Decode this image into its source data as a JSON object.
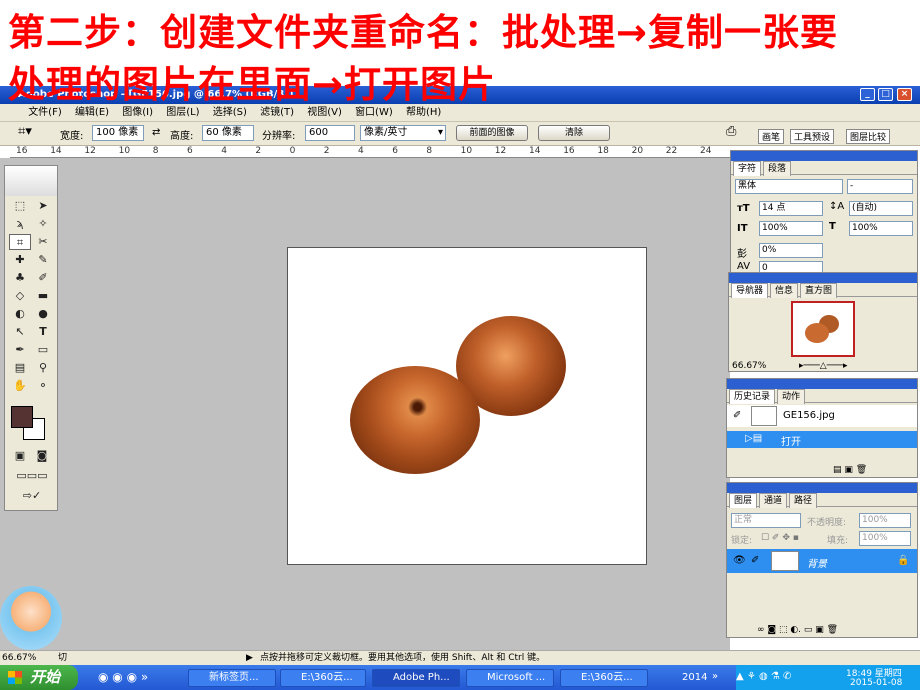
{
  "slide": {
    "heading_line1": "第二步：创建文件夹重命名：批处理→复制一张要",
    "heading_line2": "处理的图片在里面→打开图片"
  },
  "window": {
    "title": "Adobe Photoshop - [GE156.jpg @ 66.7% (RGB/8)]",
    "buttons": [
      "_",
      "□",
      "×"
    ]
  },
  "menu": [
    "文件(F)",
    "编辑(E)",
    "图像(I)",
    "图层(L)",
    "选择(S)",
    "滤镜(T)",
    "视图(V)",
    "窗口(W)",
    "帮助(H)"
  ],
  "options": {
    "width_label": "宽度:",
    "width_value": "100 像素",
    "height_label": "高度:",
    "height_value": "60 像素",
    "resolution_label": "分辨率:",
    "resolution_value": "600",
    "unit_value": "像素/英寸",
    "front_image_button": "前面的图像",
    "clear_button": "清除",
    "palette_tabs": [
      "画笔",
      "工具预设",
      "图层比较"
    ]
  },
  "ruler_labels": [
    "16",
    "14",
    "12",
    "10",
    "8",
    "6",
    "4",
    "2",
    "0",
    "2",
    "4",
    "6",
    "8",
    "10",
    "12",
    "14",
    "16",
    "18",
    "20",
    "22",
    "24"
  ],
  "character_panel": {
    "tabs": [
      "字符",
      "段落"
    ],
    "font": "黑体",
    "style": "-",
    "size": "14 点",
    "leading": "(自动)",
    "vscale": "100%",
    "hscale": "100%",
    "baseline": "0%",
    "tracking": "0"
  },
  "navigator_panel": {
    "tabs": [
      "导航器",
      "信息",
      "直方图"
    ],
    "zoom": "66.67%"
  },
  "history_panel": {
    "tabs": [
      "历史记录",
      "动作"
    ],
    "snapshot": "GE156.jpg",
    "step": "打开"
  },
  "layers_panel": {
    "tabs": [
      "图层",
      "通道",
      "路径"
    ],
    "blend_mode": "正常",
    "opacity_label": "不透明度:",
    "opacity_value": "100%",
    "lock_label": "锁定:",
    "fill_label": "填充:",
    "fill_value": "100%",
    "layer_name": "背景"
  },
  "status": {
    "zoom": "66.67%",
    "tool_hint": "切",
    "message": "点按并拖移可定义裁切框。要用其他选项，使用 Shift、Alt 和 Ctrl 键。"
  },
  "taskbar": {
    "start": "开始",
    "tasks": [
      "新标签页...",
      "E:\\360云...",
      "Adobe Ph...",
      "Microsoft ...",
      "E:\\360云..."
    ],
    "active_task": "Adobe Ph...",
    "year": "2014",
    "time": "18:49 星期四",
    "date": "2015-01-08"
  },
  "colors": {
    "heading": "#ff0000",
    "titlebar": "#0a3fb0",
    "taskbar": "#2358d3",
    "selection": "#2f8ff0",
    "foreground": "#553333"
  }
}
